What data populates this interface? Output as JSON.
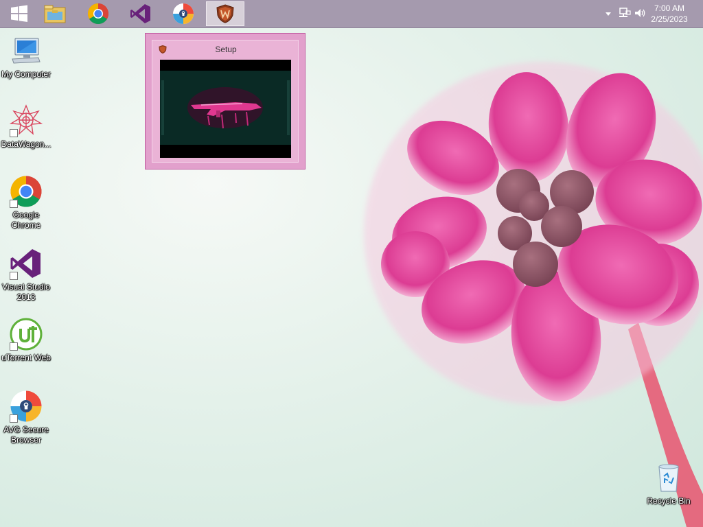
{
  "taskbar": {
    "pinned": [
      {
        "name": "start-button",
        "icon": "windows-logo-icon"
      },
      {
        "name": "file-explorer",
        "icon": "folder-icon"
      },
      {
        "name": "google-chrome",
        "icon": "chrome-icon"
      },
      {
        "name": "visual-studio",
        "icon": "visual-studio-icon"
      },
      {
        "name": "avg-secure-browser",
        "icon": "avg-browser-icon"
      },
      {
        "name": "setup-app",
        "icon": "shield-w-icon",
        "active": true
      }
    ],
    "clock": {
      "time": "7:00 AM",
      "date": "2/25/2023"
    }
  },
  "preview": {
    "title": "Setup"
  },
  "desktop": {
    "icons": [
      {
        "label": "My Computer",
        "icon": "computer-icon"
      },
      {
        "label": "DataWagon...",
        "icon": "datawagon-icon"
      },
      {
        "label": "Google Chrome",
        "icon": "chrome-icon"
      },
      {
        "label": "Visual Studio 2013",
        "icon": "visual-studio-icon"
      },
      {
        "label": "uTorrent Web",
        "icon": "utorrent-icon"
      },
      {
        "label": "AVG Secure Browser",
        "icon": "avg-browser-icon"
      },
      {
        "label": "Recycle Bin",
        "icon": "recycle-bin-icon"
      }
    ]
  },
  "colors": {
    "taskbar": "#a59aae",
    "preview_border": "#e2a0cc",
    "flower": "#e0449a",
    "vs_purple": "#68217a",
    "utorrent_green": "#5fb13a"
  }
}
